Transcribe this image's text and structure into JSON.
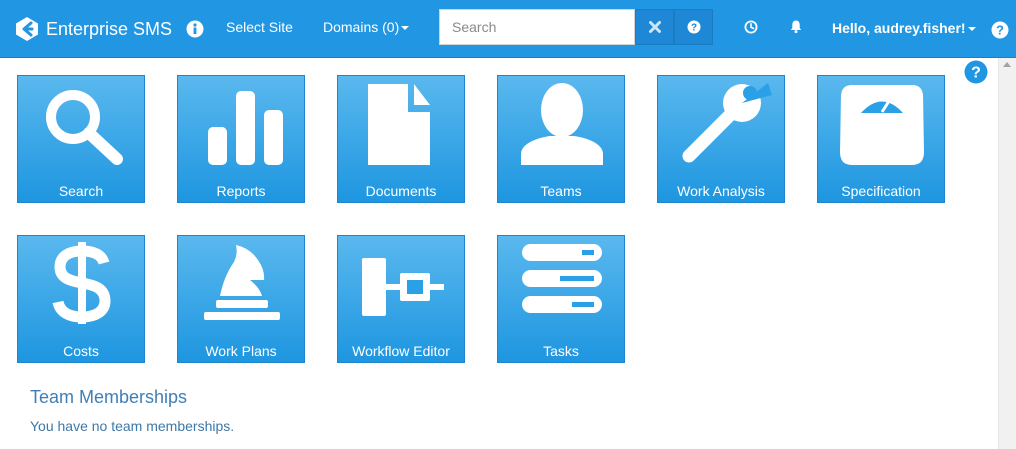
{
  "navbar": {
    "brand": "Enterprise SMS",
    "brand_icon": "enterprise-logo-icon",
    "info_icon": "info-circle-icon",
    "select_site": "Select Site",
    "domains": "Domains (0)",
    "search_placeholder": "Search",
    "clear_icon": "close-icon",
    "search_help_icon": "question-circle-icon",
    "history_icon": "clock-icon",
    "notifications_icon": "bell-icon",
    "greeting": "Hello, audrey.fisher!",
    "help_icon": "question-circle-icon"
  },
  "tiles": [
    {
      "label": "Search",
      "icon": "magnifier-icon"
    },
    {
      "label": "Reports",
      "icon": "bar-chart-icon"
    },
    {
      "label": "Documents",
      "icon": "document-icon"
    },
    {
      "label": "Teams",
      "icon": "user-icon"
    },
    {
      "label": "Work Analysis",
      "icon": "wrench-icon"
    },
    {
      "label": "Specification",
      "icon": "scale-icon"
    },
    {
      "label": "Costs",
      "icon": "dollar-icon"
    },
    {
      "label": "Work Plans",
      "icon": "chess-knight-icon"
    },
    {
      "label": "Workflow Editor",
      "icon": "workflow-icon"
    },
    {
      "label": "Tasks",
      "icon": "tasks-icon"
    }
  ],
  "team_memberships": {
    "title": "Team Memberships",
    "message": "You have no team memberships."
  },
  "colors": {
    "navbar": "#2196e3",
    "tile_top": "#5ab8ee",
    "tile_bottom": "#1e96e0",
    "heading": "#3f7fb5"
  }
}
